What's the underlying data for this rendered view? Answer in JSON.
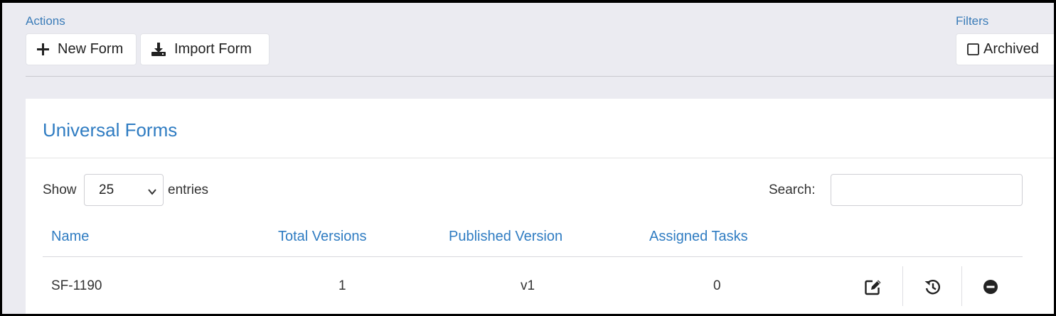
{
  "actions": {
    "label": "Actions",
    "new_form": "New Form",
    "import_form": "Import Form"
  },
  "filters": {
    "label": "Filters",
    "archived": "Archived"
  },
  "panel": {
    "title": "Universal Forms",
    "show_label": "Show",
    "page_size": "25",
    "entries_label": "entries",
    "search_label": "Search:",
    "search_value": ""
  },
  "table": {
    "columns": [
      "Name",
      "Total Versions",
      "Published Version",
      "Assigned Tasks"
    ],
    "rows": [
      {
        "name": "SF-1190",
        "total_versions": "1",
        "published_version": "v1",
        "assigned_tasks": "0"
      }
    ]
  },
  "icons": {
    "new": "plus-icon",
    "import": "download-icon",
    "edit": "edit-icon",
    "history": "history-icon",
    "remove": "minus-circle-icon"
  },
  "colors": {
    "accent": "#2f7cc2",
    "background": "#ebebf1"
  }
}
